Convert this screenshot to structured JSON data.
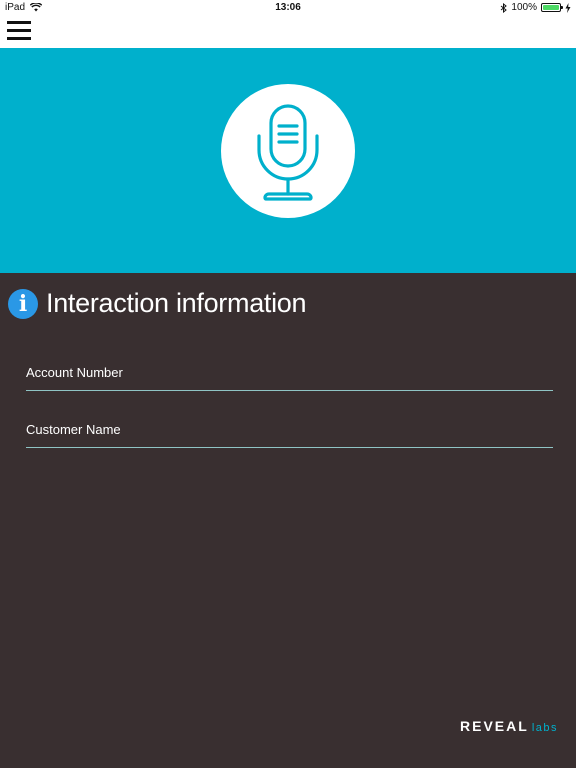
{
  "status_bar": {
    "device": "iPad",
    "time": "13:06",
    "battery": "100%",
    "battery_level": 1.0
  },
  "nav": {
    "menu_icon": "hamburger-icon"
  },
  "hero": {
    "background": "#00b0cc",
    "icon": "microphone-icon"
  },
  "section": {
    "icon": "info-icon",
    "icon_glyph": "i",
    "title": "Interaction information"
  },
  "fields": {
    "account_number": {
      "placeholder": "Account Number",
      "value": ""
    },
    "customer_name": {
      "placeholder": "Customer Name",
      "value": ""
    }
  },
  "brand": {
    "main": "REVEAL",
    "sub": "labs"
  },
  "colors": {
    "accent": "#00b0cc",
    "background": "#392f30",
    "info": "#2a98e6"
  }
}
